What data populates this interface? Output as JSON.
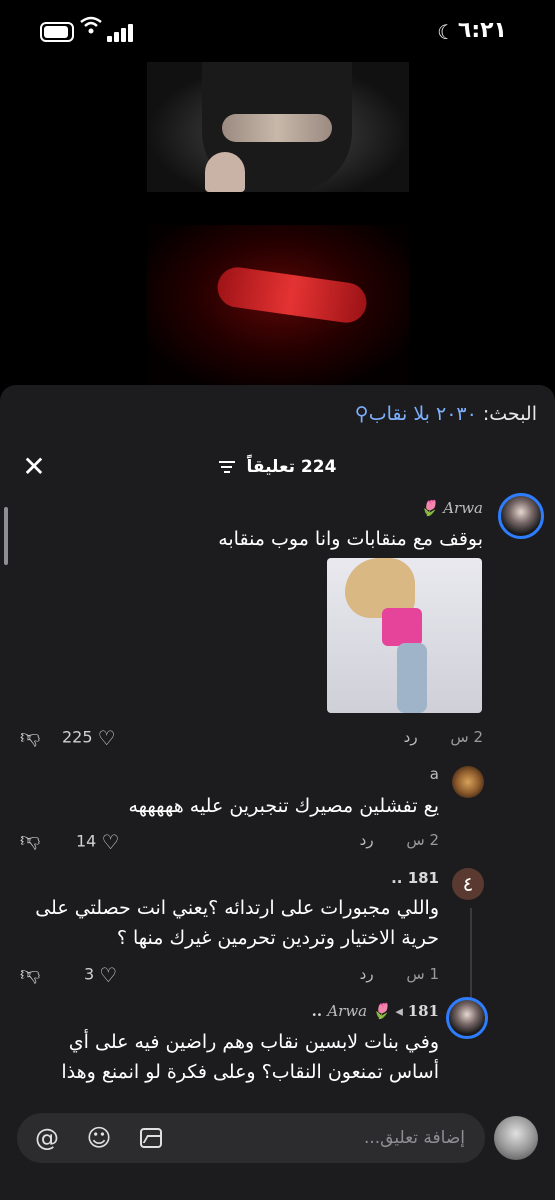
{
  "status": {
    "time": "٦:٢١",
    "icons": [
      "moon-icon",
      "battery-icon",
      "wifi-icon",
      "signal-icon"
    ]
  },
  "search": {
    "label": "البحث:",
    "query": "٢٠٣٠ بلا نقاب",
    "icon": "search-icon"
  },
  "comments_header": {
    "count": "224 تعليقاً",
    "filter_icon": "filter-icon",
    "close_icon": "close-icon"
  },
  "comments": [
    {
      "user": "Arwa",
      "emoji": "🌷",
      "text": "بوقف مع منقابات وانا موب منقابه",
      "time": "2 س",
      "reply": "رد",
      "likes": "225",
      "has_gif": true
    },
    {
      "user": "a",
      "text": "يع تفشلين مصيرك تنجبرين عليه هههههه",
      "time": "2 س",
      "reply": "رد",
      "likes": "14"
    },
    {
      "user": "181 ..",
      "avatar_letter": "٤",
      "text": "واللي مجبورات على ارتدائه ؟يعني انت حصلتي على حرية الاختيار وتردين تحرمين غيرك منها ؟",
      "time": "1 س",
      "reply": "رد",
      "likes": "3"
    },
    {
      "user": "Arwa",
      "emoji": "🌷",
      "reply_to": "181 ..",
      "text": "وفي بنات لابسين نقاب وهم راضين فيه على أي أساس تمنعون النقاب؟ وعلى فكرة لو انمنع وهذا"
    }
  ],
  "composer": {
    "placeholder": "إضافة تعليق...",
    "icons": [
      "image-icon",
      "emoji-icon",
      "mention-icon"
    ]
  },
  "colors": {
    "sheet_bg": "#1c1c1e",
    "accent_link": "#7fb0ff",
    "ring": "#2f7dff"
  }
}
